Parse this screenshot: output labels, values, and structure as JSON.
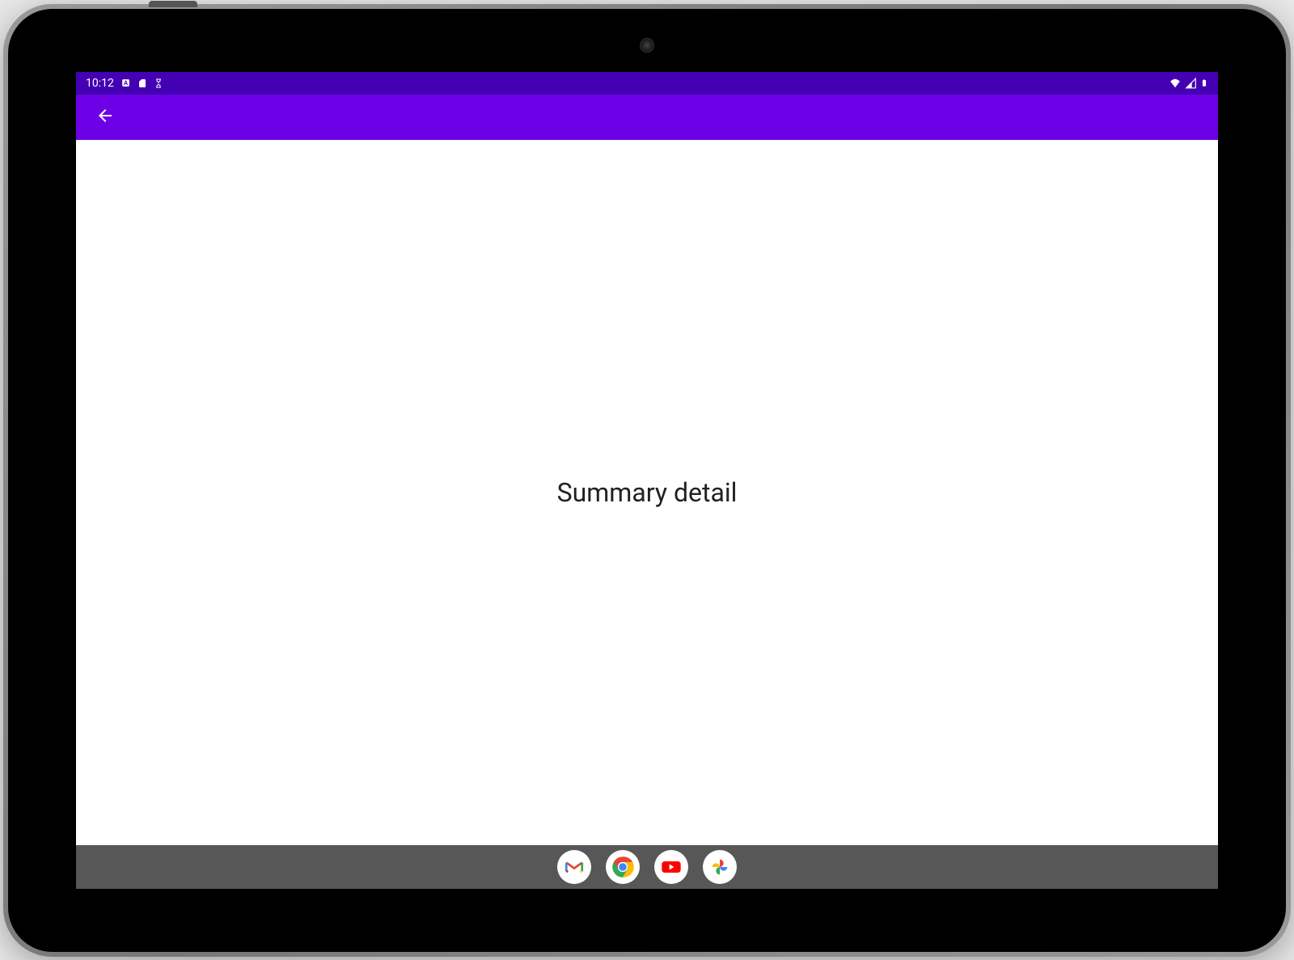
{
  "status_bar": {
    "time": "10:12",
    "colors": {
      "background": "#4400b3"
    }
  },
  "app_bar": {
    "colors": {
      "background": "#6d00e6"
    }
  },
  "content": {
    "text": "Summary detail"
  },
  "nav_bar": {
    "apps": [
      "gmail",
      "chrome",
      "youtube",
      "photos"
    ]
  }
}
